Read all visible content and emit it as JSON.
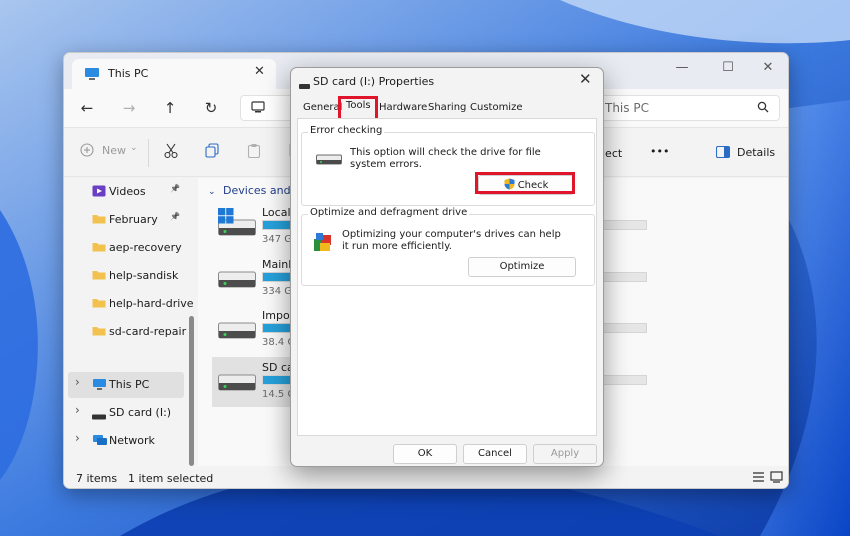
{
  "explorer": {
    "tab_title": "This PC",
    "search_placeholder": "Search This PC",
    "search_visible": "This PC",
    "commands": {
      "new": "New",
      "eject_fragment": "ject",
      "more": "•••",
      "details": "Details"
    },
    "sidebar": {
      "quick_access": [
        {
          "label": "Videos",
          "pinned": true,
          "icon": "videos-folder-icon"
        },
        {
          "label": "February",
          "pinned": true,
          "icon": "folder-icon"
        },
        {
          "label": "aep-recovery",
          "pinned": false,
          "icon": "folder-icon"
        },
        {
          "label": "help-sandisk",
          "pinned": false,
          "icon": "folder-icon"
        },
        {
          "label": "help-hard-drive",
          "pinned": false,
          "icon": "folder-icon"
        },
        {
          "label": "sd-card-repair",
          "pinned": false,
          "icon": "folder-icon"
        }
      ],
      "tree": [
        {
          "label": "This PC",
          "selected": true,
          "icon": "monitor-icon"
        },
        {
          "label": "SD card (I:)",
          "selected": false,
          "icon": "drive-icon"
        },
        {
          "label": "Network",
          "selected": false,
          "icon": "network-icon"
        }
      ]
    },
    "content": {
      "group_header": "Devices and dri",
      "drives": [
        {
          "name": "Local",
          "free": "347 G",
          "used_fraction": 0.42,
          "windows": true,
          "selected": false
        },
        {
          "name": "MainP",
          "free": "334 G",
          "used_fraction": 0.38,
          "windows": false,
          "selected": false
        },
        {
          "name": "Impor",
          "free": "38.4 G",
          "used_fraction": 0.45,
          "windows": false,
          "selected": false
        },
        {
          "name": "SD ca",
          "free": "14.5 G",
          "used_fraction": 0.1,
          "windows": false,
          "selected": true
        }
      ]
    },
    "status": {
      "items": "7 items",
      "selected": "1 item selected"
    }
  },
  "dialog": {
    "title": "SD card (I:) Properties",
    "tabs": [
      "General",
      "Tools",
      "Hardware",
      "Sharing",
      "Customize"
    ],
    "active_tab": "Tools",
    "error_checking": {
      "title": "Error checking",
      "description": "This option will check the drive for file system errors.",
      "button": "Check"
    },
    "optimize": {
      "title": "Optimize and defragment drive",
      "description": "Optimizing your computer's drives can help it run more efficiently.",
      "button": "Optimize"
    },
    "footer": {
      "ok": "OK",
      "cancel": "Cancel",
      "apply": "Apply"
    }
  },
  "colors": {
    "highlight": "#e0152b",
    "drive_bar": "#26a0da",
    "folder": "#f2c14e"
  }
}
